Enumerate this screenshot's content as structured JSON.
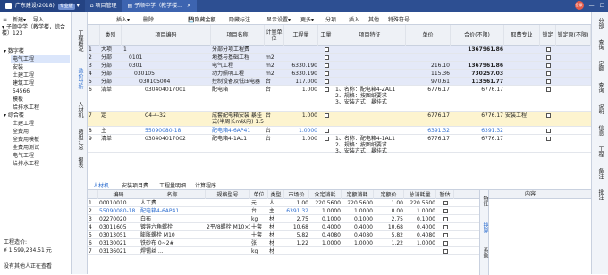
{
  "titlebar": {
    "tabs": [
      {
        "label": "广东建设(2018)",
        "badge": "专业版"
      },
      {
        "label": "项目管理"
      },
      {
        "label": "子顺中学（教学楼..."
      }
    ],
    "avatar": "登录"
  },
  "leftpanel": {
    "toolbar": [
      "新建▾",
      "导入"
    ],
    "project_name": "子顺中学（教学楼，综合楼）123",
    "tree": [
      {
        "label": "数字楼",
        "level": 0
      },
      {
        "label": "电气工程",
        "level": 1,
        "selected": true
      },
      {
        "label": "安装",
        "level": 1
      },
      {
        "label": "土建工程",
        "level": 1
      },
      {
        "label": "建筑工程",
        "level": 1
      },
      {
        "label": "54566",
        "level": 1
      },
      {
        "label": "模板",
        "level": 1
      },
      {
        "label": "给排水工程",
        "level": 1
      },
      {
        "label": "综合楼",
        "level": 0
      },
      {
        "label": "土建工程",
        "level": 1
      },
      {
        "label": "全费用",
        "level": 1
      },
      {
        "label": "全费用模板",
        "level": 1
      },
      {
        "label": "全费用测试",
        "level": 1
      },
      {
        "label": "电气工程",
        "level": 1
      },
      {
        "label": "给排水工程",
        "level": 1
      }
    ],
    "cost_label": "工程造价:",
    "cost_value": "¥ 1,599,234.51 元",
    "footer": "没有其他人正在查看"
  },
  "vtabs": [
    "工程概况",
    "造价分析",
    "人材机",
    "费用汇总",
    "报表"
  ],
  "toolbar": [
    "插入▾",
    "删除",
    "💾隐藏金额",
    "隐藏标注",
    "显示设置▾",
    "更多▾",
    "分项",
    "插入",
    "其他",
    "特殊符号"
  ],
  "grid": {
    "headers": [
      "",
      "类别",
      "项目编码",
      "项目名称",
      "计量单位",
      "工程量",
      "工量",
      "项目特征",
      "单价",
      "合价(不限)",
      "取费专业",
      "锁定",
      "锁定原(不限)"
    ],
    "rows": [
      {
        "num": "1",
        "type": "大项",
        "code": "1",
        "name": "分部分项工程费",
        "unit": "",
        "qty": "",
        "feature": "",
        "price": "",
        "total": "1367961.86",
        "fee": "",
        "band": "blue"
      },
      {
        "num": "2",
        "type": "分部",
        "code": "0101",
        "name": "地基与基础工程",
        "unit": "m2",
        "qty": "",
        "feature": "",
        "price": "",
        "total": "",
        "fee": "",
        "band": "blue"
      },
      {
        "num": "3",
        "type": "分部",
        "code": "0301",
        "name": "电气工程",
        "unit": "m2",
        "qty": "6330.190",
        "feature": "",
        "price": "216.10",
        "total": "1367961.86",
        "fee": "",
        "band": "blue"
      },
      {
        "num": "4",
        "type": "分部",
        "code": "030105",
        "name": "动力照明工程",
        "unit": "m2",
        "qty": "6330.190",
        "feature": "",
        "price": "115.36",
        "total": "730257.03",
        "fee": "",
        "band": "blue"
      },
      {
        "num": "5",
        "type": "分部",
        "code": "030105004",
        "name": "控制设备及低压电器",
        "unit": "台",
        "qty": "117.000",
        "feature": "",
        "price": "970.61",
        "total": "113561.77",
        "fee": "",
        "band": "blue"
      },
      {
        "num": "6",
        "type": "清单",
        "code": "030404017001",
        "name": "配电箱",
        "unit": "台",
        "qty": "1.000",
        "feature": "1、名称：配电箱4-ZAL1\n2、规格：按图纸要求\n3、安装方式：暴挂式",
        "price": "6776.17",
        "total": "6776.17",
        "fee": "",
        "band": "white"
      },
      {
        "num": "7",
        "type": "定",
        "code": "C4-4-32",
        "name": "成套配电箱安装 暴挂式(半周长m以内) 1.5",
        "unit": "台",
        "qty": "1.000",
        "feature": "",
        "price": "6776.17",
        "total": "6776.17",
        "fee": "安装工程",
        "band": "yellow"
      },
      {
        "num": "8",
        "type": "主",
        "code": "55090080-18",
        "name": "配电箱4-6AP41",
        "unit": "台",
        "qty": "1.0000",
        "feature": "",
        "price": "6391.32",
        "total": "6391.32",
        "fee": "",
        "band": "white",
        "link": true
      },
      {
        "num": "9",
        "type": "清单",
        "code": "030404017002",
        "name": "配电箱4-1AL1",
        "unit": "台",
        "qty": "1.000",
        "feature": "1、名称：配电箱4-1AL1\n2、规格：按图纸要求\n3、安装方式：暴挂式",
        "price": "6776.17",
        "total": "6776.17",
        "fee": "",
        "band": "white"
      }
    ]
  },
  "rightbar": [
    "分部",
    "查询",
    "定额",
    "查询",
    "说明",
    "信息",
    "工程",
    "备注",
    "批注"
  ],
  "lower": {
    "tabs": [
      "人材机",
      "安装项目费",
      "工程量明细",
      "计算程序"
    ],
    "headers": [
      "",
      "编码",
      "类别",
      "名称",
      "规格型号",
      "单位",
      "类型",
      "市场价",
      "含定消耗",
      "定额消耗",
      "定额价",
      "总消耗量",
      "暂估"
    ],
    "rows": [
      {
        "num": "1",
        "code": "00010010",
        "cat": "人",
        "name": "人工费",
        "spec": "",
        "unit": "元",
        "type": "人",
        "market": "1.00",
        "qty1": "220.5600",
        "qty2": "220.5600",
        "price": "1.00",
        "total": "220.5600"
      },
      {
        "num": "2",
        "code": "55090080-18",
        "cat": "主",
        "name": "配电箱4-6AP41",
        "spec": "",
        "unit": "台",
        "type": "主",
        "market": "6391.32",
        "qty1": "1.0000",
        "qty2": "1.0000",
        "price": "0.00",
        "total": "1.0000",
        "link": true
      },
      {
        "num": "3",
        "code": "02270020",
        "cat": "材",
        "name": "白布",
        "spec": "",
        "unit": "kg",
        "type": "材",
        "market": "2.75",
        "qty1": "0.1000",
        "qty2": "0.1000",
        "price": "2.75",
        "total": "0.1000"
      },
      {
        "num": "4",
        "code": "03011605",
        "cat": "材",
        "name": "镀锌六角螺栓",
        "spec": "2平/8螺栓 M10×100以…",
        "unit": "十套",
        "type": "材",
        "market": "10.68",
        "qty1": "0.4000",
        "qty2": "0.4000",
        "price": "10.68",
        "total": "0.4000"
      },
      {
        "num": "5",
        "code": "03013051",
        "cat": "材",
        "name": "膨胀螺栓 M10",
        "spec": "",
        "unit": "十套",
        "type": "材",
        "market": "5.82",
        "qty1": "0.4080",
        "qty2": "0.4080",
        "price": "5.82",
        "total": "0.4080"
      },
      {
        "num": "6",
        "code": "03130021",
        "cat": "材",
        "name": "铁砂布 0~2#",
        "spec": "",
        "unit": "张",
        "type": "材",
        "market": "1.22",
        "qty1": "1.0000",
        "qty2": "1.0000",
        "price": "1.22",
        "total": "1.0000"
      },
      {
        "num": "7",
        "code": "03136021",
        "cat": "材",
        "name": "焊锡丝 ...",
        "spec": "",
        "unit": "kg",
        "type": "材",
        "market": "",
        "qty1": "",
        "qty2": "",
        "price": "",
        "total": ""
      }
    ],
    "side_tabs": [
      "特征",
      "换算",
      "系数"
    ],
    "prop_header": "内容"
  }
}
